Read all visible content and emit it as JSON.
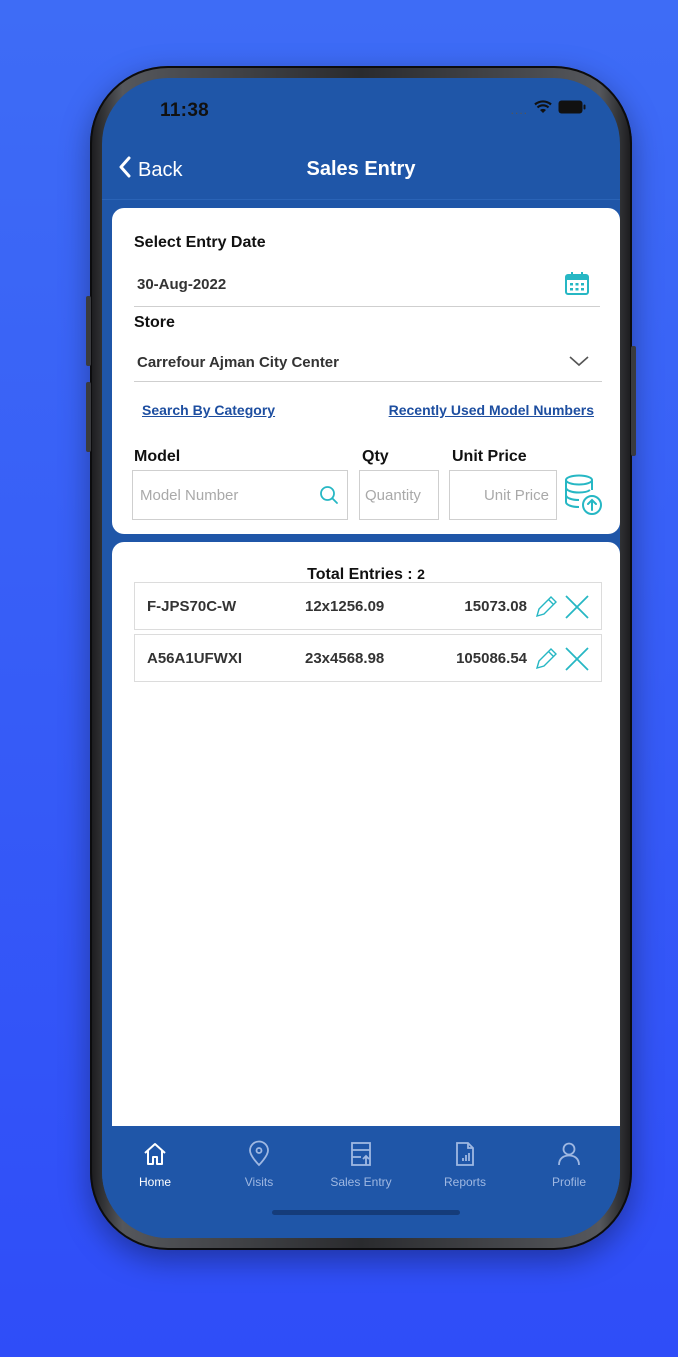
{
  "status": {
    "time": "11:38"
  },
  "nav": {
    "back_label": "Back",
    "title": "Sales Entry"
  },
  "form": {
    "date_label": "Select Entry Date",
    "date_value": "30-Aug-2022",
    "store_label": "Store",
    "store_value": "Carrefour Ajman City Center",
    "search_category_link": "Search By Category",
    "recent_models_link": "Recently Used Model Numbers",
    "model_label": "Model",
    "qty_label": "Qty",
    "unit_price_label": "Unit Price",
    "model_placeholder": "Model Number",
    "qty_placeholder": "Quantity",
    "unit_price_placeholder": "Unit Price"
  },
  "entries": {
    "total_label": "Total Entries : ",
    "total_count": "2",
    "rows": [
      {
        "model": "F-JPS70C-W",
        "qty_price": "12x1256.09",
        "total": "15073.08"
      },
      {
        "model": "A56A1UFWXI",
        "qty_price": "23x4568.98",
        "total": "105086.54"
      }
    ]
  },
  "tabs": [
    {
      "label": "Home",
      "icon": "home-icon"
    },
    {
      "label": "Visits",
      "icon": "location-pin-icon"
    },
    {
      "label": "Sales Entry",
      "icon": "sales-entry-icon"
    },
    {
      "label": "Reports",
      "icon": "report-icon"
    },
    {
      "label": "Profile",
      "icon": "profile-icon"
    }
  ],
  "colors": {
    "background": "#3e6cf6",
    "primary": "#1f56a8",
    "link": "#1d4ea0",
    "accent_teal": "#26b7c4",
    "tab_inactive": "#9fb8e2"
  }
}
